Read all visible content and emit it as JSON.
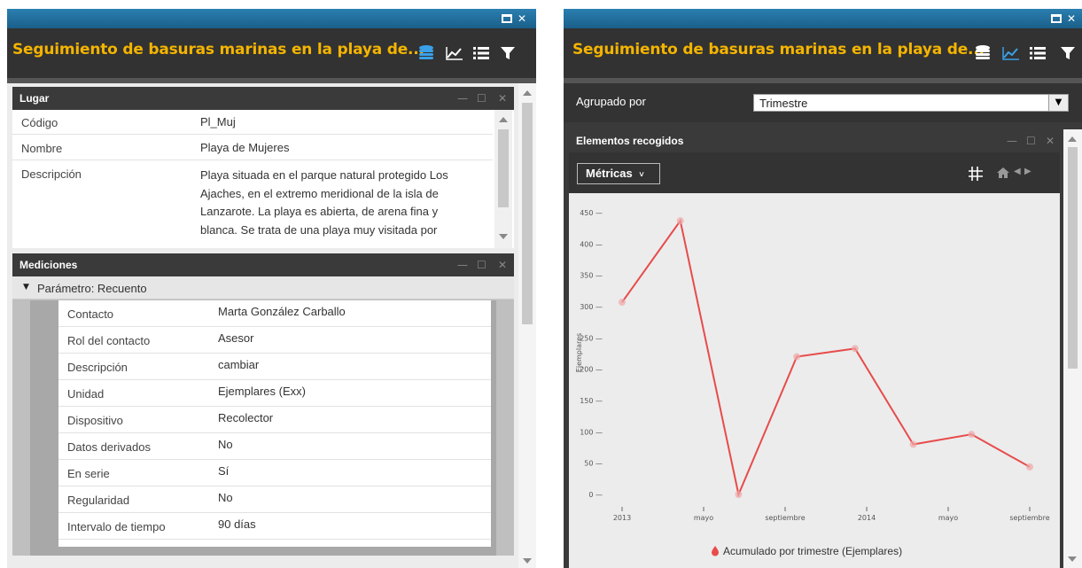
{
  "left_window": {
    "title": "Seguimiento de basuras marinas en la playa de...",
    "lugar": {
      "title": "Lugar",
      "rows": [
        {
          "key": "Código",
          "value": "Pl_Muj"
        },
        {
          "key": "Nombre",
          "value": "Playa de Mujeres"
        },
        {
          "key": "Descripción",
          "lines": [
            "Playa situada en el parque natural protegido Los",
            "Ajaches, en el extremo meridional de la isla de",
            "Lanzarote. La playa es abierta, de arena fina y",
            "blanca. Se trata de una playa muy visitada por"
          ]
        }
      ]
    },
    "mediciones": {
      "title": "Mediciones",
      "group": "Parámetro: Recuento",
      "rows": [
        {
          "key": "Contacto",
          "value": "Marta González Carballo"
        },
        {
          "key": "Rol del contacto",
          "value": "Asesor"
        },
        {
          "key": "Descripción",
          "value": "cambiar"
        },
        {
          "key": "Unidad",
          "value": "Ejemplares (Exx)"
        },
        {
          "key": "Dispositivo",
          "value": "Recolector"
        },
        {
          "key": "Datos derivados",
          "value": "No"
        },
        {
          "key": "En serie",
          "value": "Sí"
        },
        {
          "key": "Regularidad",
          "value": "No"
        },
        {
          "key": "Intervalo de tiempo",
          "value": "90 días"
        }
      ]
    }
  },
  "right_window": {
    "title": "Seguimiento de basuras marinas en la playa de...",
    "group_by_label": "Agrupado por",
    "group_by_value": "Trimestre",
    "chart_panel_title": "Elementos recogidos",
    "metrics_button": "Métricas",
    "legend": "Acumulado por trimestre (Ejemplares)",
    "accent_color": "#e84b4b",
    "title_color": "#f4b400"
  },
  "chart_data": {
    "type": "line",
    "x_labels": [
      "2013",
      "mayo",
      "septiembre",
      "2014",
      "mayo",
      "septiembre"
    ],
    "series": [
      {
        "name": "Acumulado por trimestre (Ejemplares)",
        "values": [
          307,
          437,
          0,
          220,
          233,
          80,
          96,
          44
        ]
      }
    ],
    "ylabel": "Ejemplares",
    "y_ticks": [
      0,
      50,
      100,
      150,
      200,
      250,
      300,
      350,
      400,
      450
    ],
    "ylim": [
      0,
      450
    ]
  }
}
